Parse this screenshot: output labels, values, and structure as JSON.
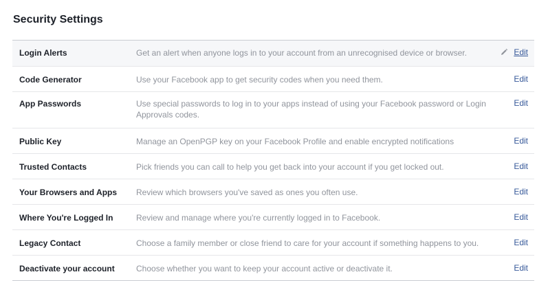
{
  "page": {
    "title": "Security Settings"
  },
  "settings": [
    {
      "label": "Login Alerts",
      "description": "Get an alert when anyone logs in to your account from an unrecognised device or browser.",
      "edit_label": "Edit"
    },
    {
      "label": "Code Generator",
      "description": "Use your Facebook app to get security codes when you need them.",
      "edit_label": "Edit"
    },
    {
      "label": "App Passwords",
      "description": "Use special passwords to log in to your apps instead of using your Facebook password or Login Approvals codes.",
      "edit_label": "Edit"
    },
    {
      "label": "Public Key",
      "description": "Manage an OpenPGP key on your Facebook Profile and enable encrypted notifications",
      "edit_label": "Edit"
    },
    {
      "label": "Trusted Contacts",
      "description": "Pick friends you can call to help you get back into your account if you get locked out.",
      "edit_label": "Edit"
    },
    {
      "label": "Your Browsers and Apps",
      "description": "Review which browsers you've saved as ones you often use.",
      "edit_label": "Edit"
    },
    {
      "label": "Where You're Logged In",
      "description": "Review and manage where you're currently logged in to Facebook.",
      "edit_label": "Edit"
    },
    {
      "label": "Legacy Contact",
      "description": "Choose a family member or close friend to care for your account if something happens to you.",
      "edit_label": "Edit"
    },
    {
      "label": "Deactivate your account",
      "description": "Choose whether you want to keep your account active or deactivate it.",
      "edit_label": "Edit"
    }
  ],
  "icons": {
    "hovered_row_edit": "pencil-icon"
  },
  "colors": {
    "link": "#365899",
    "label": "#1d2129",
    "description": "#90949c",
    "hover_row_bg": "#f6f7f9"
  }
}
